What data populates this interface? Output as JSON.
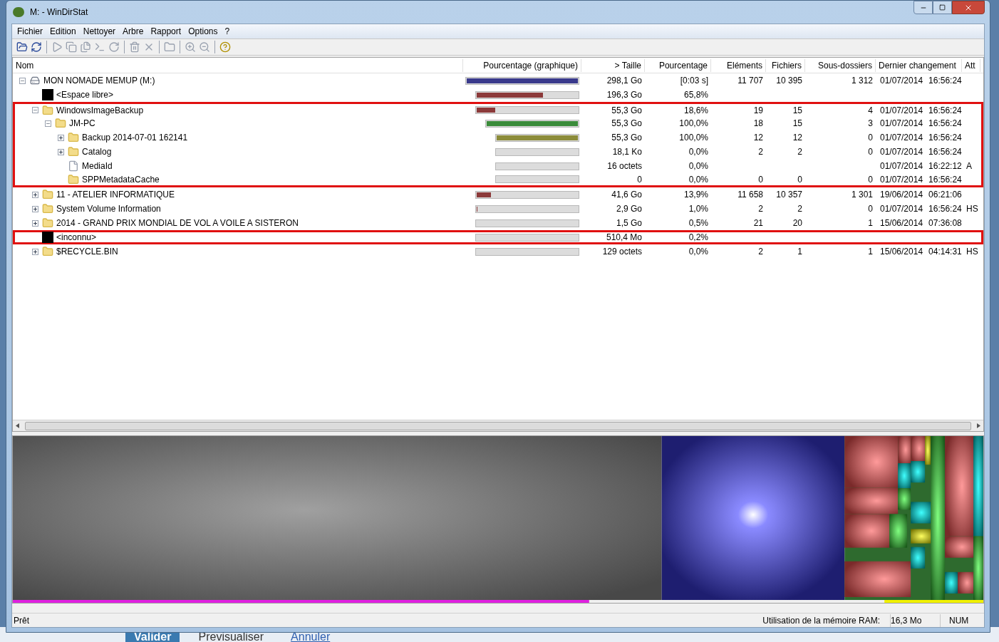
{
  "window": {
    "title": "M: - WinDirStat"
  },
  "menu": [
    "Fichier",
    "Edition",
    "Nettoyer",
    "Arbre",
    "Rapport",
    "Options",
    "?"
  ],
  "table": {
    "columns": [
      "Nom",
      "Pourcentage (graphique)",
      "> Taille",
      "Pourcentage",
      "Eléments",
      "Fichiers",
      "Sous-dossiers",
      "Dernier changement",
      "Att"
    ],
    "rows": [
      {
        "name": "MON NOMADE MEMUP (M:)",
        "kind": "drive",
        "expanded": true,
        "highlighted": false,
        "level": 1,
        "color": "#3a3a8c",
        "size": "298,1 Go",
        "percent": "[0:03 s]",
        "elements": "11 707",
        "files": "10 395",
        "subdirs": "1 312",
        "date": "01/07/2014",
        "time": "16:56:24",
        "children": [
          {
            "name": "<Espace libre>",
            "kind": "special",
            "highlighted": false,
            "level": 0.658,
            "color": "#8c3a3a",
            "size": "196,3 Go",
            "percent": "65,8%"
          },
          {
            "name": "WindowsImageBackup",
            "kind": "folder",
            "expanded": true,
            "highlighted": true,
            "level": 0.186,
            "color": "#8c3a3a",
            "size": "55,3 Go",
            "percent": "18,6%",
            "elements": "19",
            "files": "15",
            "subdirs": "4",
            "date": "01/07/2014",
            "time": "16:56:24",
            "children": [
              {
                "name": "JM-PC",
                "kind": "folder",
                "expanded": true,
                "highlighted": true,
                "level": 1,
                "color": "#3a8c3a",
                "size": "55,3 Go",
                "percent": "100,0%",
                "elements": "18",
                "files": "15",
                "subdirs": "3",
                "date": "01/07/2014",
                "time": "16:56:24",
                "children": [
                  {
                    "name": "Backup 2014-07-01 162141",
                    "kind": "folder",
                    "expanded": false,
                    "highlighted": true,
                    "level": 1,
                    "color": "#8c8c3a",
                    "size": "55,3 Go",
                    "percent": "100,0%",
                    "elements": "12",
                    "files": "12",
                    "subdirs": "0",
                    "date": "01/07/2014",
                    "time": "16:56:24"
                  },
                  {
                    "name": "Catalog",
                    "kind": "folder",
                    "expanded": false,
                    "highlighted": true,
                    "size": "18,1 Ko",
                    "percent": "0,0%",
                    "elements": "2",
                    "files": "2",
                    "subdirs": "0",
                    "date": "01/07/2014",
                    "time": "16:56:24"
                  },
                  {
                    "name": "MediaId",
                    "kind": "file",
                    "highlighted": true,
                    "size": "16 octets",
                    "percent": "0,0%",
                    "date": "01/07/2014",
                    "time": "16:22:12",
                    "attr": "A"
                  },
                  {
                    "name": "SPPMetadataCache",
                    "kind": "folder",
                    "highlighted": true,
                    "size": "0",
                    "percent": "0,0%",
                    "elements": "0",
                    "files": "0",
                    "subdirs": "0",
                    "date": "01/07/2014",
                    "time": "16:56:24"
                  }
                ]
              }
            ]
          },
          {
            "name": "11 - ATELIER INFORMATIQUE",
            "kind": "folder",
            "expanded": false,
            "highlighted": false,
            "level": 0.139,
            "color": "#8c3a3a",
            "size": "41,6 Go",
            "percent": "13,9%",
            "elements": "11 658",
            "files": "10 357",
            "subdirs": "1 301",
            "date": "19/06/2014",
            "time": "06:21:06"
          },
          {
            "name": "System Volume Information",
            "kind": "folder",
            "expanded": false,
            "highlighted": false,
            "level": 0.01,
            "color": "#8c3a3a",
            "size": "2,9 Go",
            "percent": "1,0%",
            "elements": "2",
            "files": "2",
            "subdirs": "0",
            "date": "01/07/2014",
            "time": "16:56:24",
            "attr": "HS"
          },
          {
            "name": "2014 - GRAND PRIX MONDIAL DE VOL A VOILE A SISTERON",
            "kind": "folder",
            "expanded": false,
            "highlighted": false,
            "size": "1,5 Go",
            "percent": "0,5%",
            "elements": "21",
            "files": "20",
            "subdirs": "1",
            "date": "15/06/2014",
            "time": "07:36:08"
          },
          {
            "name": "<inconnu>",
            "kind": "special",
            "highlighted": true,
            "size": "510,4 Mo",
            "percent": "0,2%"
          },
          {
            "name": "$RECYCLE.BIN",
            "kind": "folder",
            "expanded": false,
            "highlighted": false,
            "size": "129 octets",
            "percent": "0,0%",
            "elements": "2",
            "files": "1",
            "subdirs": "1",
            "date": "15/06/2014",
            "time": "04:14:31",
            "attr": "HS"
          }
        ]
      }
    ]
  },
  "status_bar": {
    "text": "Prêt",
    "ram_label": "Utilisation de la mémoire RAM:",
    "ram_value": "16,3 Mo",
    "num": "NUM"
  },
  "background_buttons": [
    "Valider",
    "Previsualiser",
    "Annuler"
  ]
}
